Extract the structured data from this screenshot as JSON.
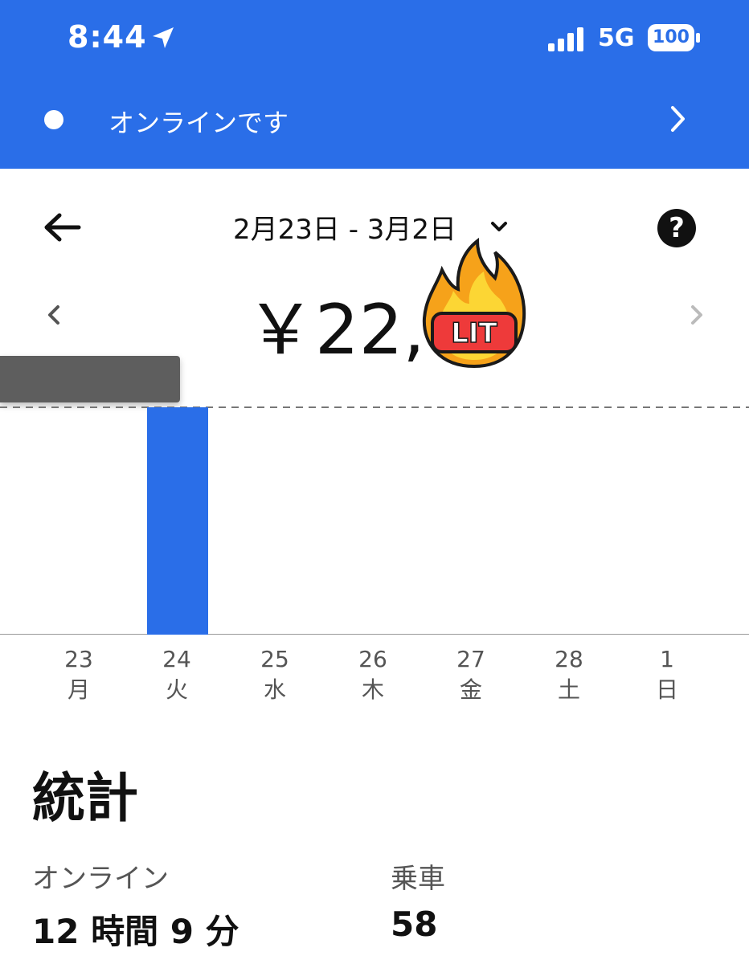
{
  "status_bar": {
    "time": "8:44",
    "network": "5G",
    "battery": "100"
  },
  "banner": {
    "status_text": "オンラインです"
  },
  "header": {
    "date_range": "2月23日 - 3月2日",
    "help_glyph": "?"
  },
  "summary": {
    "total": "￥22,7"
  },
  "sticker": {
    "text": "LIT"
  },
  "chart_data": {
    "type": "bar",
    "categories": [
      "23",
      "24",
      "25",
      "26",
      "27",
      "28",
      "1"
    ],
    "weekdays": [
      "月",
      "火",
      "水",
      "木",
      "金",
      "土",
      "日"
    ],
    "values": [
      0,
      1,
      0,
      0,
      0,
      0,
      0
    ],
    "ylim": [
      0,
      1
    ],
    "bar_color": "#2a6ee8",
    "grid": false
  },
  "stats": {
    "title": "統計",
    "online_label": "オンライン",
    "online_value": "12 時間 9 分",
    "rides_label": "乗車",
    "rides_value": "58"
  },
  "colors": {
    "brand": "#2a6ee8",
    "tooltip": "#5e5e5e"
  }
}
